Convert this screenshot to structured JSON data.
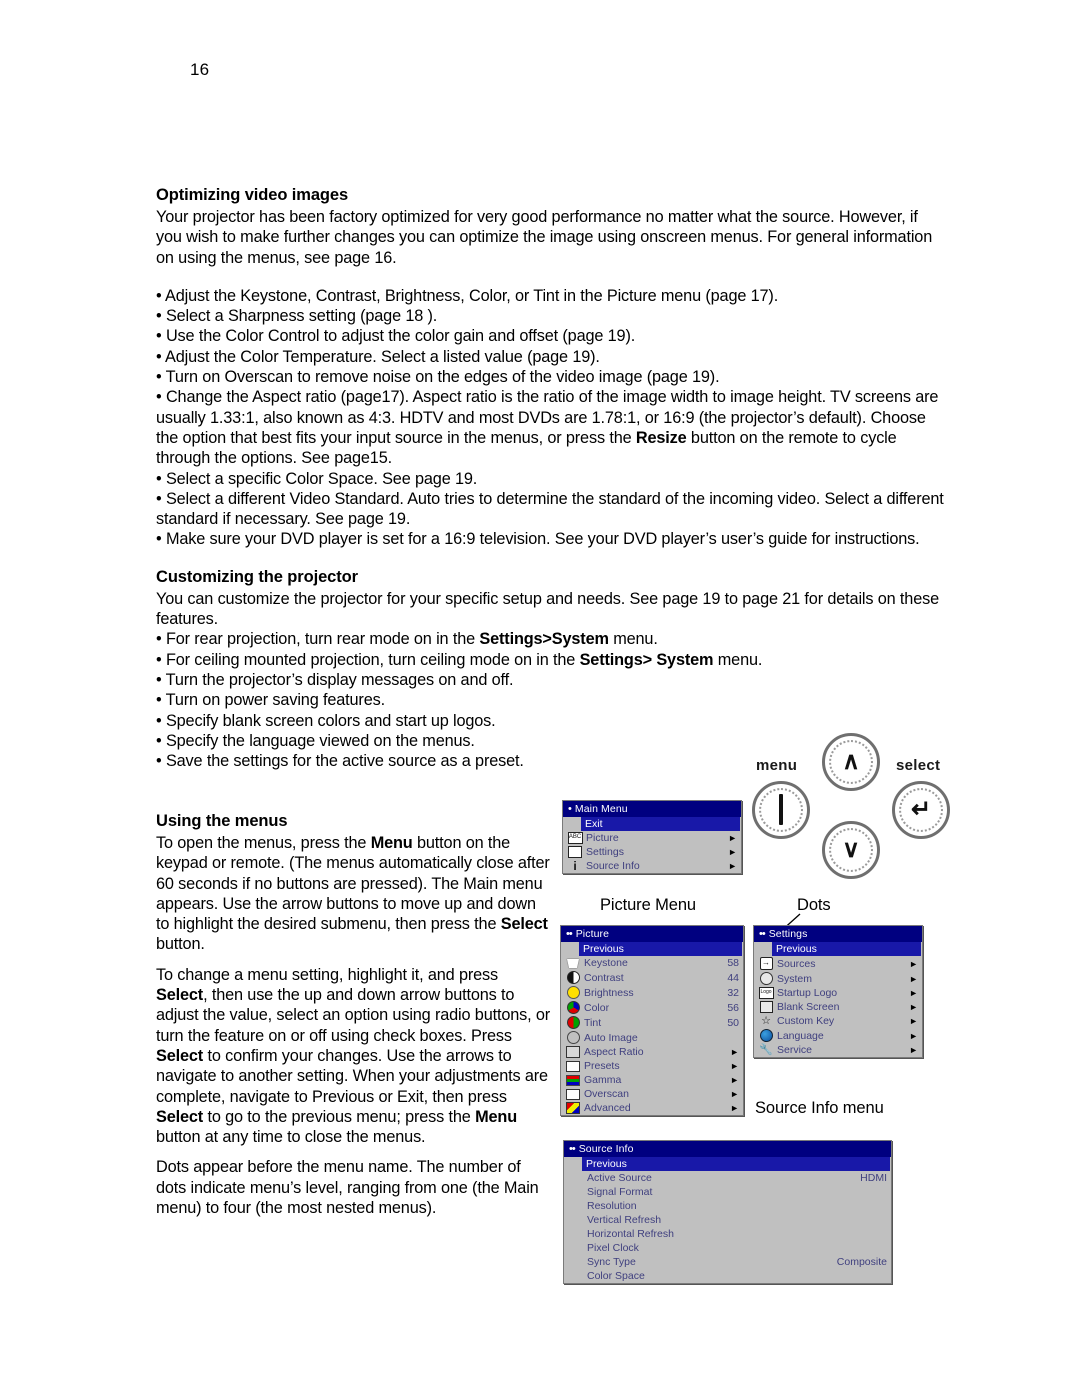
{
  "page": {
    "number": "16"
  },
  "sections": {
    "optimizing": {
      "heading": "Optimizing video images",
      "intro": "Your projector has been factory optimized for very good performance no matter what the source. However, if you wish to make further changes you can optimize the image using onscreen menus. For general information on using the menus, see page 16.",
      "bullets": [
        "Adjust the Keystone, Contrast, Brightness, Color, or Tint in the Picture menu (page 17).",
        "Select a Sharpness setting (page 18 ).",
        "Use the Color Control to adjust the color gain and offset (page 19).",
        "Adjust the Color Temperature. Select a listed value (page 19).",
        "Turn on Overscan to remove noise on the edges of the video image (page 19)."
      ],
      "aspect_bullet_a": "Change the Aspect ratio (page17). Aspect ratio is the ratio of the image width to image height. TV screens are usually 1.33:1, also known as 4:3. HDTV and most DVDs are 1.78:1, or 16:9 (the projector’s default). Choose the option that best fits your input source in the menus, or press the ",
      "aspect_bullet_bold": "Resize",
      "aspect_bullet_b": " button on the remote to cycle through the options. See page15.",
      "bullets_tail": [
        "Select a specific Color Space. See page 19.",
        "Select a different Video Standard. Auto tries to determine the standard of the incoming video. Select a different standard if necessary. See page 19.",
        "Make sure your DVD player is set for a 16:9 television. See your DVD player’s user’s guide for instructions."
      ]
    },
    "customizing": {
      "heading": "Customizing the projector",
      "intro": "You can customize the projector for your specific setup and needs. See page 19 to page 21 for details on these features.",
      "bullets": [
        {
          "pre": "For rear projection, turn rear mode on in the ",
          "bold": "Settings>System",
          "post": " menu."
        },
        {
          "pre": "For ceiling mounted projection, turn ceiling mode on in the ",
          "bold": "Settings> System",
          "post": " menu."
        },
        {
          "pre": "Turn the projector’s display messages on and off.",
          "bold": "",
          "post": ""
        },
        {
          "pre": "Turn on power saving features.",
          "bold": "",
          "post": ""
        },
        {
          "pre": "Specify blank screen colors and start up logos.",
          "bold": "",
          "post": ""
        },
        {
          "pre": "Specify the language viewed on the menus.",
          "bold": "",
          "post": ""
        },
        {
          "pre": "Save the settings for the active source as a preset.",
          "bold": "",
          "post": ""
        }
      ]
    },
    "using_menus": {
      "heading": "Using the menus",
      "p1_a": "To open the menus, press the ",
      "p1_bold": "Menu",
      "p1_b": " button on the keypad or remote. (The menus automatically close after 60 seconds if no buttons are pressed). The Main menu appears. Use the arrow buttons to move up and down to highlight the desired submenu, then press the ",
      "p1_bold2": "Select",
      "p1_c": " button.",
      "p2_a": "To change a menu setting, highlight it, and press ",
      "p2_bold1": "Select",
      "p2_b": ", then use the up and down arrow buttons to adjust the value, select an option using radio buttons, or turn the feature on or off using check boxes. Press ",
      "p2_bold2": "Select",
      "p2_c": " to confirm your changes. Use the arrows to navigate to another setting. When your adjustments are complete, navigate to Previous or Exit, then press ",
      "p2_bold3": "Select",
      "p2_d": " to go to the previous menu; press the ",
      "p2_bold4": "Menu",
      "p2_e": " button at any time to close the menus.",
      "p3": "Dots appear before the menu name. The number of dots indicate menu’s level, ranging from one (the Main menu) to four (the most nested menus)."
    }
  },
  "keypad": {
    "menu_label": "menu",
    "select_label": "select",
    "up_glyph": "∧",
    "down_glyph": "∨",
    "select_glyph": "↵"
  },
  "captions": {
    "picture_menu": "Picture Menu",
    "dots": "Dots",
    "source_info_menu": "Source Info menu"
  },
  "osd": {
    "main_menu": {
      "dots": "•",
      "title": "Main Menu",
      "rows": [
        {
          "label": "Exit",
          "value": "",
          "arrow": "",
          "highlight": true,
          "icon": ""
        },
        {
          "label": "Picture",
          "value": "",
          "arrow": "►",
          "highlight": false,
          "icon": "abc-icon"
        },
        {
          "label": "Settings",
          "value": "",
          "arrow": "►",
          "highlight": false,
          "icon": "settings-book-icon"
        },
        {
          "label": "Source Info",
          "value": "",
          "arrow": "►",
          "highlight": false,
          "icon": "info-icon"
        }
      ]
    },
    "picture_menu": {
      "dots": "••",
      "title": "Picture",
      "rows": [
        {
          "label": "Previous",
          "value": "",
          "arrow": "",
          "highlight": true,
          "icon": ""
        },
        {
          "label": "Keystone",
          "value": "58",
          "arrow": "",
          "highlight": false,
          "icon": "keystone-icon"
        },
        {
          "label": "Contrast",
          "value": "44",
          "arrow": "",
          "highlight": false,
          "icon": "contrast-icon"
        },
        {
          "label": "Brightness",
          "value": "32",
          "arrow": "",
          "highlight": false,
          "icon": "brightness-icon"
        },
        {
          "label": "Color",
          "value": "56",
          "arrow": "",
          "highlight": false,
          "icon": "color-icon"
        },
        {
          "label": "Tint",
          "value": "50",
          "arrow": "",
          "highlight": false,
          "icon": "tint-icon"
        },
        {
          "label": "Auto Image",
          "value": "",
          "arrow": "",
          "highlight": false,
          "icon": "auto-image-icon"
        },
        {
          "label": "Aspect Ratio",
          "value": "",
          "arrow": "►",
          "highlight": false,
          "icon": "aspect-ratio-icon"
        },
        {
          "label": "Presets",
          "value": "",
          "arrow": "►",
          "highlight": false,
          "icon": "presets-icon"
        },
        {
          "label": "Gamma",
          "value": "",
          "arrow": "►",
          "highlight": false,
          "icon": "gamma-icon"
        },
        {
          "label": "Overscan",
          "value": "",
          "arrow": "►",
          "highlight": false,
          "icon": "overscan-icon"
        },
        {
          "label": "Advanced",
          "value": "",
          "arrow": "►",
          "highlight": false,
          "icon": "advanced-icon"
        }
      ]
    },
    "settings_menu": {
      "dots": "••",
      "title": "Settings",
      "rows": [
        {
          "label": "Previous",
          "value": "",
          "arrow": "",
          "highlight": true,
          "icon": ""
        },
        {
          "label": "Sources",
          "value": "",
          "arrow": "►",
          "highlight": false,
          "icon": "sources-icon"
        },
        {
          "label": "System",
          "value": "",
          "arrow": "►",
          "highlight": false,
          "icon": "system-icon"
        },
        {
          "label": "Startup Logo",
          "value": "",
          "arrow": "►",
          "highlight": false,
          "icon": "startup-logo-icon"
        },
        {
          "label": "Blank Screen",
          "value": "",
          "arrow": "►",
          "highlight": false,
          "icon": "blank-screen-icon"
        },
        {
          "label": "Custom Key",
          "value": "",
          "arrow": "►",
          "highlight": false,
          "icon": "custom-key-icon"
        },
        {
          "label": "Language",
          "value": "",
          "arrow": "►",
          "highlight": false,
          "icon": "language-icon"
        },
        {
          "label": "Service",
          "value": "",
          "arrow": "►",
          "highlight": false,
          "icon": "service-icon"
        }
      ]
    },
    "source_info_menu": {
      "dots": "••",
      "title": "Source Info",
      "rows": [
        {
          "label": "Previous",
          "value": "",
          "arrow": "",
          "highlight": true,
          "icon": ""
        },
        {
          "label": "Active Source",
          "value": "HDMI",
          "arrow": "",
          "highlight": false,
          "icon": ""
        },
        {
          "label": "Signal Format",
          "value": "",
          "arrow": "",
          "highlight": false,
          "icon": ""
        },
        {
          "label": "Resolution",
          "value": "",
          "arrow": "",
          "highlight": false,
          "icon": ""
        },
        {
          "label": "Vertical Refresh",
          "value": "",
          "arrow": "",
          "highlight": false,
          "icon": ""
        },
        {
          "label": "Horizontal Refresh",
          "value": "",
          "arrow": "",
          "highlight": false,
          "icon": ""
        },
        {
          "label": "Pixel Clock",
          "value": "",
          "arrow": "",
          "highlight": false,
          "icon": ""
        },
        {
          "label": "Sync Type",
          "value": "Composite",
          "arrow": "",
          "highlight": false,
          "icon": ""
        },
        {
          "label": "Color Space",
          "value": "",
          "arrow": "",
          "highlight": false,
          "icon": ""
        }
      ]
    }
  },
  "colors": {
    "osd_titlebar": "#000080",
    "osd_background": "#c0c0c0",
    "osd_highlight": "#1818a8",
    "osd_text": "#40407f"
  }
}
